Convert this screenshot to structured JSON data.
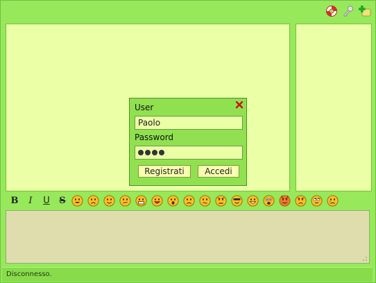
{
  "toolbar": {
    "icons": [
      "lifebuoy-icon",
      "key-icon",
      "add-user-icon"
    ]
  },
  "login": {
    "user_label": "User",
    "user_value": "Paolo",
    "password_label": "Password",
    "password_length": 4,
    "register_label": "Registrati",
    "login_label": "Accedi"
  },
  "format": {
    "bold": "B",
    "italic": "I",
    "underline": "U",
    "strike": "S"
  },
  "smileys": [
    "grin",
    "sad",
    "smile",
    "unsure",
    "teeth",
    "laugh",
    "surprised",
    "frown",
    "worried",
    "mad",
    "cool",
    "biggrin",
    "shocked",
    "devil",
    "angry",
    "rolleyes",
    "crying"
  ],
  "status": {
    "text": "Disconnesso."
  },
  "colors": {
    "background": "#97e85b",
    "panel": "#eaffa6",
    "input_area": "#dfddae",
    "close_x": "#cc1111"
  }
}
